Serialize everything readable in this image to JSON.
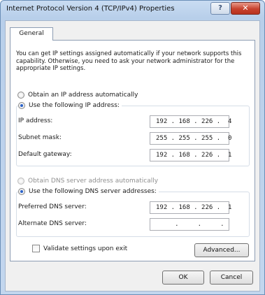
{
  "window": {
    "title": "Internet Protocol Version 4 (TCP/IPv4) Properties",
    "help_label": "?",
    "close_label": "✕"
  },
  "tabs": [
    {
      "label": "General",
      "active": true
    }
  ],
  "intro_text": "You can get IP settings assigned automatically if your network supports this capability. Otherwise, you need to ask your network administrator for the appropriate IP settings.",
  "ip_section": {
    "auto_label": "Obtain an IP address automatically",
    "auto_selected": false,
    "manual_label": "Use the following IP address:",
    "manual_selected": true,
    "fields": [
      {
        "label": "IP address:",
        "value": "192 . 168 . 226 .  4"
      },
      {
        "label": "Subnet mask:",
        "value": "255 . 255 . 255 .  0"
      },
      {
        "label": "Default gateway:",
        "value": "192 . 168 . 226 .  1"
      }
    ]
  },
  "dns_section": {
    "auto_label": "Obtain DNS server address automatically",
    "auto_selected": false,
    "auto_disabled": true,
    "manual_label": "Use the following DNS server addresses:",
    "manual_selected": true,
    "fields": [
      {
        "label": "Preferred DNS server:",
        "value": "192 . 168 . 226 .  1"
      },
      {
        "label": "Alternate DNS server:",
        "value": "     .     .     ."
      }
    ]
  },
  "validate": {
    "label": "Validate settings upon exit",
    "checked": false
  },
  "buttons": {
    "advanced": "Advanced...",
    "ok": "OK",
    "cancel": "Cancel"
  },
  "colors": {
    "title_bar": "#c3d6ee",
    "close_button": "#c7422d",
    "selected_radio": "#2a62c8"
  }
}
